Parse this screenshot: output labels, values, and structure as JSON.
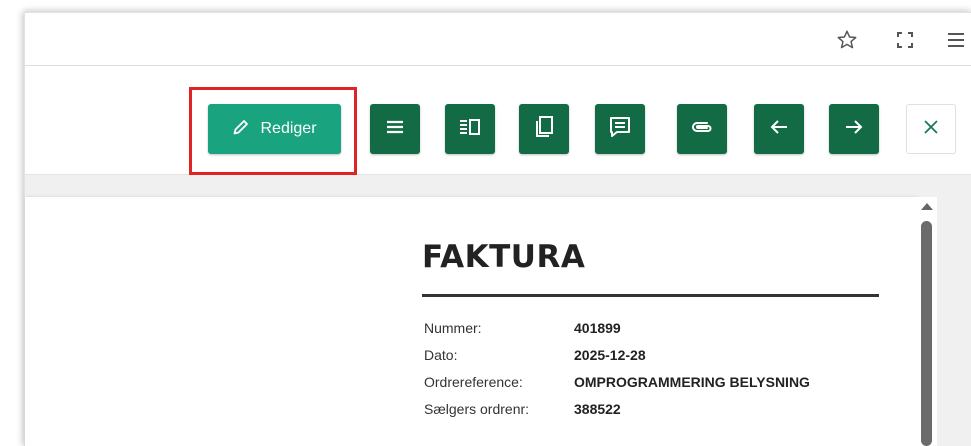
{
  "browser": {
    "icons": [
      "star-icon",
      "fullscreen-icon",
      "menu-icon"
    ]
  },
  "toolbar": {
    "edit_label": "Rediger",
    "edit_color": "#1aa37f",
    "button_color": "#136b45",
    "highlight_color": "#e02424",
    "buttons": [
      "list-icon",
      "columns-icon",
      "copy-icon",
      "comment-icon",
      "attachment-icon",
      "arrow-left-icon",
      "arrow-right-icon"
    ],
    "close_icon": "close-icon"
  },
  "invoice": {
    "title": "FAKTURA",
    "fields": [
      {
        "label": "Nummer:",
        "value": "401899"
      },
      {
        "label": "Dato:",
        "value": "2025-12-28"
      },
      {
        "label": "Ordrereference:",
        "value": "OMPROGRAMMERING BELYSNING"
      },
      {
        "label": "Sælgers ordrenr:",
        "value": "388522"
      }
    ]
  }
}
